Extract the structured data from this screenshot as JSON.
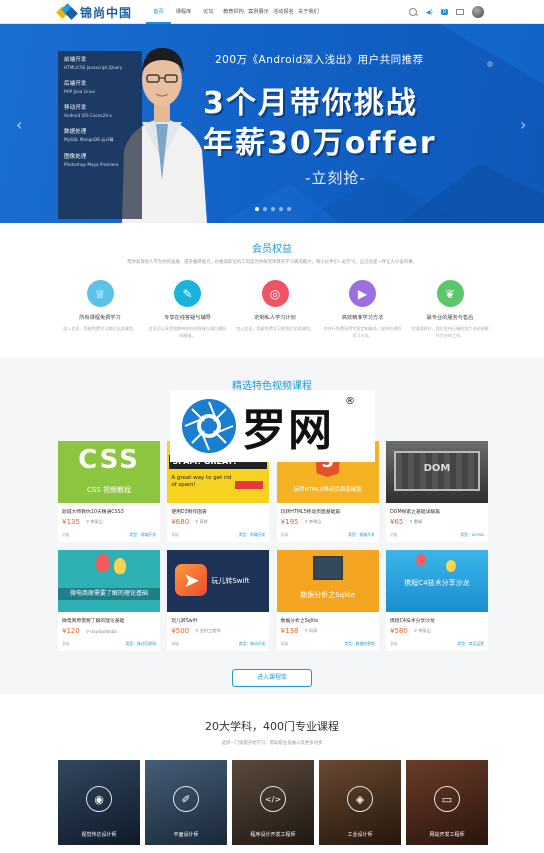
{
  "nav": {
    "brand": "锦尚中国",
    "items": [
      "首页",
      "课程库",
      "论坛",
      "教育机构",
      "案例展示",
      "活动报名",
      "关于我们"
    ],
    "badge": "0"
  },
  "banner": {
    "side_menu": [
      {
        "title": "前端开发",
        "sub": "HTML/CSS  Javascript  jQuery"
      },
      {
        "title": "后端开发",
        "sub": "PHP  Java  Linux"
      },
      {
        "title": "移动开发",
        "sub": "Android  IOS  Cocos2d-x"
      },
      {
        "title": "数据处理",
        "sub": "MySQL  MongoDB  云计算"
      },
      {
        "title": "图像处理",
        "sub": "Photoshop  Maya  Premiere"
      }
    ],
    "subtitle": "200万《Android深入浅出》用户共同推荐",
    "headline1": "3个月带你挑战",
    "headline2": "年薪30万offer",
    "cta": "-立刻抢-"
  },
  "membership": {
    "title": "会员权益",
    "desc": "帮你发现别人不为你的发展，提升搬砖能力，价格高职位的工资是为你研究项目的学习真的最大，和小伙伴们一起学习，自己也是一件让人兴奋的事。",
    "benefits": [
      {
        "name": "所有课程免费学习",
        "desc": "加入会员，您能免费学习我们全部课程。",
        "color": "#5cc2e6",
        "icon": "vip-icon",
        "glyph": "♕"
      },
      {
        "name": "专享在线答疑与辅导",
        "desc": "会员可以享受到期待的在线答疑与课后辅导的服务。",
        "color": "#1ab3dc",
        "icon": "certificate-icon",
        "glyph": "✎"
      },
      {
        "name": "定制私人学习计划",
        "desc": "加入会员，您能免费学习到我们全部课程。",
        "color": "#ef5466",
        "icon": "target-icon",
        "glyph": "◎"
      },
      {
        "name": "高效精准学习方法",
        "desc": "你并行免费获得专家定制服务，安排合理的学习方法。",
        "color": "#9b6fe0",
        "icon": "play-icon",
        "glyph": "▶"
      },
      {
        "name": "最专业的服务与售后",
        "desc": "学家团结在，我们坚持正确的努力评价结果作为业的工作。",
        "color": "#5cc66a",
        "icon": "leaf-icon",
        "glyph": "❦"
      }
    ]
  },
  "courses": {
    "title": "精选特色视频课程",
    "rows": [
      [
        {
          "name": "颜诚大师教你10天精通CSS3",
          "price": "¥135",
          "teacher": "李丽山",
          "level": "初级",
          "cat": "类型：前端开发",
          "img_text": "CSS",
          "img_sub": "CSS 视频教程"
        },
        {
          "name": "使用D3制作图表",
          "price": "¥680",
          "teacher": "蒋岭",
          "level": "初级",
          "cat": "类型：前端开发",
          "img_text": "SPAM! GREAT!",
          "img_sub": "A great way to get rid of spam!"
        },
        {
          "name": "玩转HTML5移动页面基础篇",
          "price": "¥195",
          "teacher": "李明山",
          "level": "初级",
          "cat": "类型：前端开发",
          "img_text": "5",
          "img_sub": "玩转HTML5移动页面基础篇"
        },
        {
          "name": "DOM探索之基础详解篇",
          "price": "¥65",
          "teacher": "雷缘",
          "level": "初级",
          "cat": "类型：WORD",
          "img_text": "DOM",
          "img_sub": ""
        }
      ],
      [
        {
          "name": "微电商原需要了解的理论基础",
          "price": "¥120",
          "teacher": "haysbolbobo",
          "level": "高级",
          "cat": "类型：移动互联网",
          "img_text": "微电商",
          "img_sub": "微电商原需要了解的理论基础"
        },
        {
          "name": "玩儿转Swift",
          "price": "¥500",
          "teacher": "金柯工程师",
          "level": "高级",
          "cat": "类型：移动开发",
          "img_text": "玩儿转Swift",
          "img_sub": ""
        },
        {
          "name": "数据分析之Sqlite",
          "price": "¥138",
          "teacher": "如泉",
          "level": "高级",
          "cat": "类型：数据库营销",
          "img_text": "数据分析之Sqlite",
          "img_sub": ""
        },
        {
          "name": "携程C4技术分享沙龙",
          "price": "¥580",
          "teacher": "李丽山",
          "level": "高级",
          "cat": "类型：商品运营",
          "img_text": "携程C4技术分享沙龙",
          "img_sub": ""
        }
      ]
    ],
    "more_label": "进入课程库"
  },
  "watermark": {
    "text": "罗网",
    "mark": "®"
  },
  "subjects": {
    "title": "20大学科，400门专业课程",
    "desc": "选择一门技能开始学习，帮助职业发展以及更多进步",
    "items": [
      {
        "name": "视觉传达设计师",
        "icon": "eye-icon",
        "glyph": "◉"
      },
      {
        "name": "平面设计师",
        "icon": "brush-icon",
        "glyph": "✐"
      },
      {
        "name": "程序设计开发工程师",
        "icon": "code-icon",
        "glyph": "</>"
      },
      {
        "name": "工业设计师",
        "icon": "cube-icon",
        "glyph": "◈"
      },
      {
        "name": "网站开发工程师",
        "icon": "monitor-icon",
        "glyph": "▭"
      }
    ]
  }
}
